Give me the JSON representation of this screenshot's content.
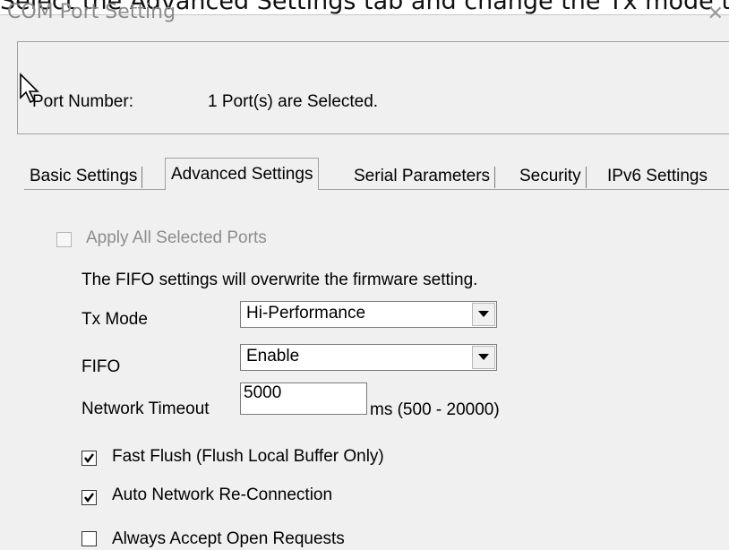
{
  "instruction": "Select the Advanced Settings tab and change the Tx mode to",
  "window": {
    "title": "COM Port Setting",
    "close_glyph": "✕"
  },
  "port": {
    "label": "Port Number:",
    "value": "1 Port(s) are Selected."
  },
  "tabs": [
    {
      "label": "Basic Settings",
      "active": false
    },
    {
      "label": "Advanced Settings",
      "active": true
    },
    {
      "label": "Serial Parameters",
      "active": false
    },
    {
      "label": "Security",
      "active": false
    },
    {
      "label": "IPv6 Settings",
      "active": false
    }
  ],
  "advanced": {
    "apply_all": {
      "label": "Apply All Selected Ports",
      "checked": false,
      "enabled": false
    },
    "fifo_note": "The FIFO settings will overwrite the firmware setting.",
    "tx_mode": {
      "label": "Tx Mode",
      "value": "Hi-Performance"
    },
    "fifo": {
      "label": "FIFO",
      "value": "Enable"
    },
    "network_timeout": {
      "label": "Network Timeout",
      "value": "5000",
      "unit": "ms (500 - 20000)"
    },
    "fast_flush": {
      "label": "Fast Flush (Flush Local Buffer Only)",
      "checked": true
    },
    "auto_reconnect": {
      "label": "Auto Network Re-Connection",
      "checked": true
    },
    "always_accept": {
      "label": "Always Accept Open Requests",
      "checked": false
    }
  },
  "icons": {
    "cursor": "mouse-pointer-icon",
    "dropdown": "dropdown-arrow-icon",
    "check": "checkmark-icon"
  }
}
